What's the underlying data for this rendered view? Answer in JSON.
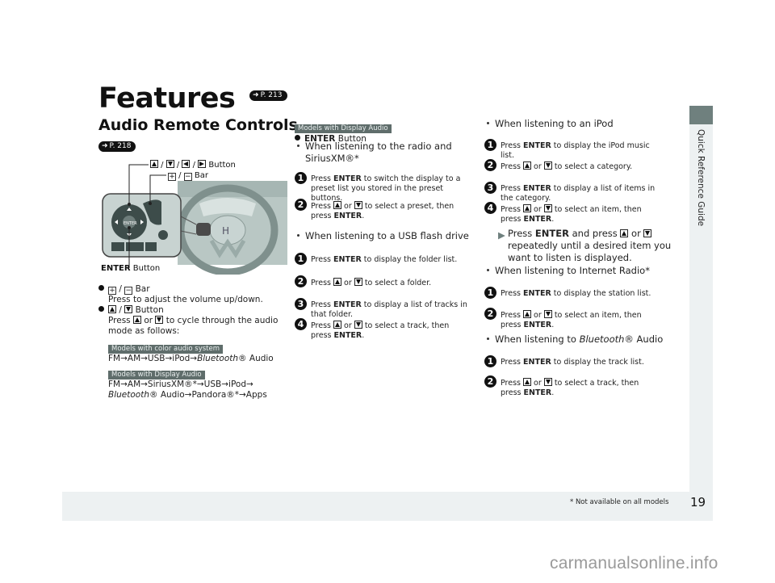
{
  "page": {
    "title": "Features",
    "title_ref": "P. 213",
    "page_number": "19",
    "footnote": "* Not available on all models",
    "side_tab": "Quick Reference Guide",
    "watermark": "carmanualsonline.info"
  },
  "colors": {
    "tag_bg": "#5f6d6b",
    "side_tab_dark": "#6f807e",
    "panel_light": "#edf1f2"
  },
  "section": {
    "title": "Audio Remote Controls",
    "ref": "P. 218",
    "illustration": {
      "caption_arrows": "Button",
      "caption_bar": "Bar",
      "caption_enter_bold": "ENTER",
      "caption_enter": "Button",
      "icons": [
        "up-arrow-key",
        "down-arrow-key",
        "left-arrow-key",
        "right-arrow-key",
        "plus-key",
        "minus-key"
      ]
    },
    "items": [
      {
        "label": "Bar",
        "desc": "Press to adjust the volume up/down."
      },
      {
        "label": "Button",
        "desc_pre": "Press",
        "desc_or": "or",
        "desc_post": "to cycle through the audio",
        "desc_line2": "mode as follows:"
      }
    ],
    "modes": [
      {
        "tag": "Models with color audio system",
        "sequence_line1": "FM→AM→USB→iPod→",
        "sequence_italic": "Bluetooth",
        "sequence_tail": "®  Audio"
      },
      {
        "tag": "Models with Display Audio",
        "sequence_line1": "FM→AM→SiriusXM®*→USB→iPod→",
        "sequence_italic": "Bluetooth",
        "sequence_tail": "®  Audio→Pandora®*→Apps"
      }
    ]
  },
  "middle": {
    "tag": "Models with Display Audio",
    "enter_bold": "ENTER",
    "enter_label": "Button",
    "groups": [
      {
        "heading_line1": "When listening to the radio and",
        "heading_line2": "SiriusXM®*",
        "steps": [
          {
            "n": "1",
            "lines": [
              "Press <b>ENTER</b> to switch the display to a",
              "preset list you stored in the preset",
              "buttons."
            ]
          },
          {
            "n": "2",
            "lines": [
              "Press ▲ or ▼ to select a preset, then",
              "press <b>ENTER</b>."
            ]
          }
        ]
      },
      {
        "heading_line1": "When listening to a USB flash drive",
        "steps": [
          {
            "n": "1",
            "lines": [
              "Press <b>ENTER</b> to display the folder list."
            ]
          },
          {
            "n": "2",
            "lines": [
              "Press ▲ or ▼ to select a folder."
            ]
          },
          {
            "n": "3",
            "lines": [
              "Press <b>ENTER</b> to display a list of tracks in",
              "that folder."
            ]
          },
          {
            "n": "4",
            "lines": [
              "Press ▲ or ▼ to select a track, then",
              "press <b>ENTER</b>."
            ]
          }
        ]
      }
    ]
  },
  "right": {
    "groups": [
      {
        "heading": "When listening to an iPod",
        "steps": [
          {
            "n": "1",
            "lines": [
              "Press <b>ENTER</b> to display the iPod music",
              "list."
            ]
          },
          {
            "n": "2",
            "lines": [
              "Press ▲ or ▼ to select a category."
            ]
          },
          {
            "n": "3",
            "lines": [
              "Press <b>ENTER</b> to display a list of items in",
              "the category."
            ]
          },
          {
            "n": "4",
            "lines": [
              "Press ▲ or ▼ to select an item, then",
              "press <b>ENTER</b>."
            ]
          }
        ],
        "note_lines": [
          "Press <b>ENTER</b> and press ▲ or ▼",
          "repeatedly until a desired item you",
          "want to listen is displayed."
        ]
      },
      {
        "heading": "When listening to Internet Radio*",
        "steps": [
          {
            "n": "1",
            "lines": [
              "Press <b>ENTER</b> to display the station list."
            ]
          },
          {
            "n": "2",
            "lines": [
              "Press ▲ or ▼ to select an item, then",
              "press <b>ENTER</b>."
            ]
          }
        ]
      },
      {
        "heading_pre": "When listening to ",
        "heading_italic": "Bluetooth",
        "heading_post": "®  Audio",
        "steps": [
          {
            "n": "1",
            "lines": [
              "Press <b>ENTER</b> to display the track list."
            ]
          },
          {
            "n": "2",
            "lines": [
              "Press ▲ or ▼ to select a track, then",
              "press <b>ENTER</b>."
            ]
          }
        ]
      }
    ]
  }
}
